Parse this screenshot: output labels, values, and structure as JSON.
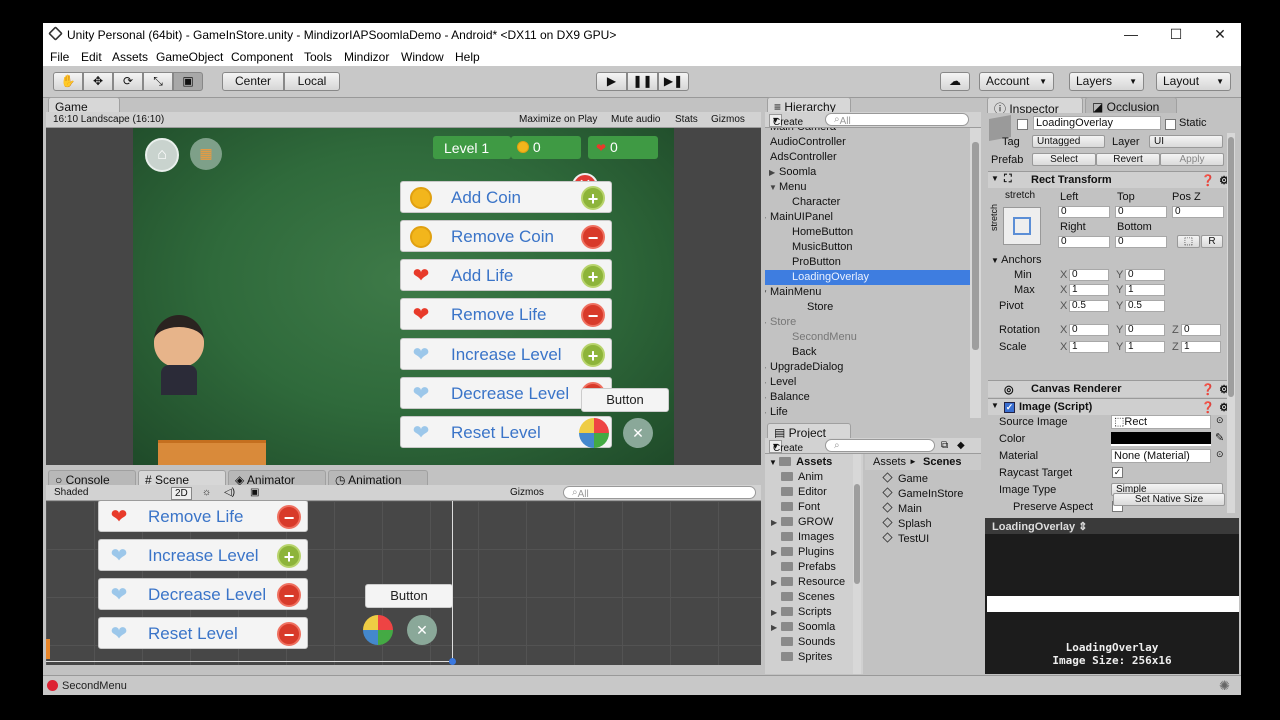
{
  "window": {
    "title": "Unity Personal (64bit) - GameInStore.unity - MindizorIAPSoomlaDemo - Android* <DX11 on DX9 GPU>",
    "minimize": "—",
    "maximize": "☐",
    "close": "✕"
  },
  "menu": [
    "File",
    "Edit",
    "Assets",
    "GameObject",
    "Component",
    "Tools",
    "Mindizor",
    "Window",
    "Help"
  ],
  "toolbar": {
    "pivot": "Center",
    "space": "Local",
    "account": "Account",
    "layers": "Layers",
    "layout": "Layout"
  },
  "game": {
    "tab": "Game",
    "aspect": "16:10 Landscape (16:10)",
    "maximize": "Maximize on Play",
    "mute": "Mute audio",
    "stats": "Stats",
    "gizmos": "Gizmos",
    "level": "Level 1",
    "coins": "0",
    "lives": "0",
    "button": "Button",
    "buttons": [
      {
        "label": "Add Coin",
        "icon": "coin",
        "action": "plus"
      },
      {
        "label": "Remove Coin",
        "icon": "coin",
        "action": "minus"
      },
      {
        "label": "Add Life",
        "icon": "heart",
        "action": "plus"
      },
      {
        "label": "Remove Life",
        "icon": "heart",
        "action": "minus"
      },
      {
        "label": "Increase Level",
        "icon": "blue-heart",
        "action": "plus"
      },
      {
        "label": "Decrease Level",
        "icon": "blue-heart",
        "action": "minus"
      },
      {
        "label": "Reset Level",
        "icon": "blue-heart",
        "action": "minus"
      }
    ]
  },
  "scene": {
    "tabs": [
      "Console",
      "Scene",
      "Animator",
      "Animation"
    ],
    "shading": "Shaded",
    "mode2d": "2D",
    "gizmos": "Gizmos",
    "search": "All",
    "button": "Button",
    "buttons": [
      {
        "label": "Remove Life",
        "icon": "heart",
        "action": "minus"
      },
      {
        "label": "Increase Level",
        "icon": "blue-heart",
        "action": "plus"
      },
      {
        "label": "Decrease Level",
        "icon": "blue-heart",
        "action": "minus"
      },
      {
        "label": "Reset Level",
        "icon": "blue-heart",
        "action": "minus"
      }
    ]
  },
  "hierarchy": {
    "tab": "Hierarchy",
    "create": "Create",
    "search": "All",
    "items": [
      {
        "label": "Main Camera",
        "indent": 1,
        "arrow": ""
      },
      {
        "label": "AudioController",
        "indent": 1,
        "arrow": ""
      },
      {
        "label": "AdsController",
        "indent": 1,
        "arrow": ""
      },
      {
        "label": "Soomla",
        "indent": 0,
        "arrow": "▶"
      },
      {
        "label": "Menu",
        "indent": 0,
        "arrow": "▼"
      },
      {
        "label": "Character",
        "indent": 2,
        "arrow": ""
      },
      {
        "label": "MainUIPanel",
        "indent": 1,
        "arrow": "▶"
      },
      {
        "label": "HomeButton",
        "indent": 2,
        "arrow": ""
      },
      {
        "label": "MusicButton",
        "indent": 2,
        "arrow": ""
      },
      {
        "label": "ProButton",
        "indent": 2,
        "arrow": ""
      },
      {
        "label": "LoadingOverlay",
        "indent": 2,
        "arrow": "",
        "selected": true
      },
      {
        "label": "MainMenu",
        "indent": 1,
        "arrow": "▼"
      },
      {
        "label": "Store",
        "indent": 3,
        "arrow": ""
      },
      {
        "label": "Store",
        "indent": 1,
        "arrow": "▶",
        "dim": true
      },
      {
        "label": "SecondMenu",
        "indent": 2,
        "arrow": "",
        "dim": true
      },
      {
        "label": "Back",
        "indent": 2,
        "arrow": ""
      },
      {
        "label": "UpgradeDialog",
        "indent": 1,
        "arrow": "▶"
      },
      {
        "label": "Level",
        "indent": 1,
        "arrow": "▶"
      },
      {
        "label": "Balance",
        "indent": 1,
        "arrow": "▶"
      },
      {
        "label": "Life",
        "indent": 1,
        "arrow": "▶"
      }
    ]
  },
  "project": {
    "tab": "Project",
    "create": "Create",
    "crumb_root": "Assets",
    "crumb_sep": "►",
    "crumb_leaf": "Scenes",
    "root": "Assets",
    "folders": [
      {
        "label": "Anim",
        "arrow": ""
      },
      {
        "label": "Editor",
        "arrow": ""
      },
      {
        "label": "Font",
        "arrow": ""
      },
      {
        "label": "GROW",
        "arrow": "▶"
      },
      {
        "label": "Images",
        "arrow": ""
      },
      {
        "label": "Plugins",
        "arrow": "▶"
      },
      {
        "label": "Prefabs",
        "arrow": ""
      },
      {
        "label": "Resource",
        "arrow": "▶"
      },
      {
        "label": "Scenes",
        "arrow": ""
      },
      {
        "label": "Scripts",
        "arrow": "▶"
      },
      {
        "label": "Soomla",
        "arrow": "▶"
      },
      {
        "label": "Sounds",
        "arrow": ""
      },
      {
        "label": "Sprites",
        "arrow": ""
      }
    ],
    "files": [
      "Game",
      "GameInStore",
      "Main",
      "Splash",
      "TestUI"
    ]
  },
  "inspector": {
    "tab": "Inspector",
    "tab2": "Occlusion",
    "object": "LoadingOverlay",
    "static": "Static",
    "tag_label": "Tag",
    "tag": "Untagged",
    "layer_label": "Layer",
    "layer": "UI",
    "prefab": "Prefab",
    "select": "Select",
    "revert": "Revert",
    "apply": "Apply",
    "rect": {
      "title": "Rect Transform",
      "stretch": "stretch",
      "left": "Left",
      "top": "Top",
      "posz": "Pos Z",
      "left_v": "0",
      "top_v": "0",
      "posz_v": "0",
      "right": "Right",
      "bottom": "Bottom",
      "right_v": "0",
      "bottom_v": "0",
      "r": "R"
    },
    "anchors": "Anchors",
    "min": "Min",
    "max": "Max",
    "pivot": "Pivot",
    "rotation": "Rotation",
    "scale": "Scale",
    "min_x": "0",
    "min_y": "0",
    "max_x": "1",
    "max_y": "1",
    "pivot_x": "0.5",
    "pivot_y": "0.5",
    "rot_x": "0",
    "rot_y": "0",
    "rot_z": "0",
    "sc_x": "1",
    "sc_y": "1",
    "sc_z": "1",
    "canvas": "Canvas Renderer",
    "image": "Image (Script)",
    "source_image": "Source Image",
    "source_val": "Rect",
    "color": "Color",
    "material": "Material",
    "material_val": "None (Material)",
    "raycast": "Raycast Target",
    "image_type": "Image Type",
    "image_type_val": "Simple",
    "preserve": "Preserve Aspect",
    "native": "Set Native Size",
    "preview_title": "LoadingOverlay",
    "preview_name": "LoadingOverlay",
    "preview_size": "Image Size: 256x16"
  },
  "status": {
    "text": "SecondMenu"
  }
}
